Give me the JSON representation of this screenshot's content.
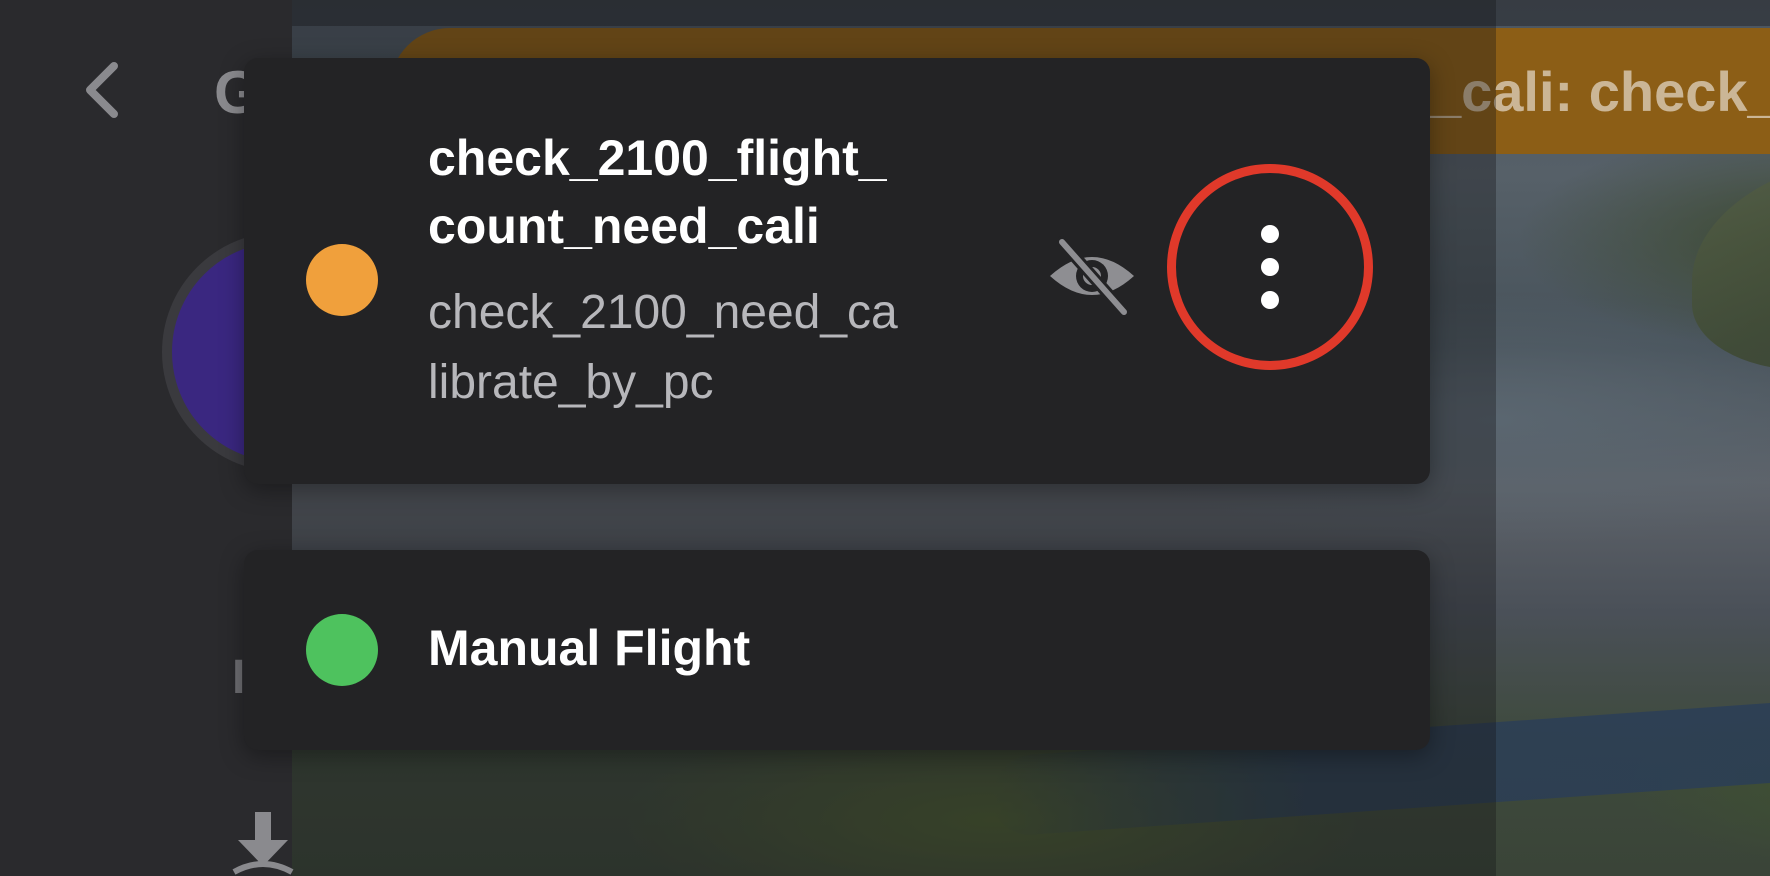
{
  "alert": {
    "text": "_cali: check_",
    "color": "#8c5e16"
  },
  "left_panel": {
    "title": "G",
    "side_letter": "I",
    "icons": [
      "chevron-left-icon",
      "download-icon"
    ],
    "avatar_color": "#3a2780"
  },
  "flights": [
    {
      "title_lines": [
        "check_2100_flight_",
        "count_need_cali"
      ],
      "subtitle_lines": [
        "check_2100_need_ca",
        "librate_by_pc"
      ],
      "status_color": "#f0a03c",
      "icons": [
        "eye-slash-icon",
        "more-vertical-icon"
      ],
      "highlight_color": "#e0392a"
    },
    {
      "title": "Manual Flight",
      "status_color": "#4ec25e"
    }
  ]
}
